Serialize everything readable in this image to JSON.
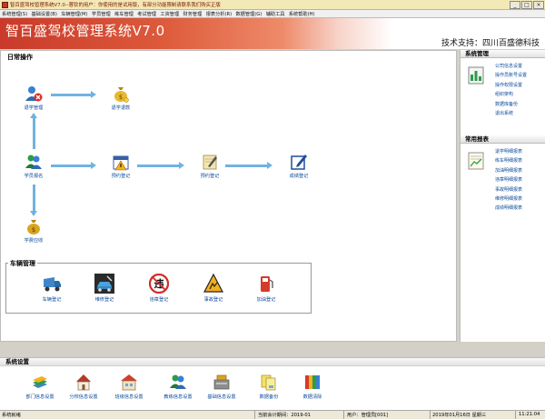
{
  "window": {
    "title": "智百盛驾校管理系统V7.0--蓉钦的用户：你使用的是试用版，有部分功能限制请联系我们购买正版",
    "minimize": "_",
    "maximize": "□",
    "close": "×"
  },
  "menu": [
    "系统管理(S)",
    "基础设置(B)",
    "车辆管理(M)",
    "学员管理",
    "练车管理",
    "考试管理",
    "工资管理",
    "财务管理",
    "报表分析(R)",
    "数据管理(G)",
    "辅助工具",
    "系统帮助(H)"
  ],
  "banner": {
    "title": "智百盛驾校管理系统V7.0",
    "support": "技术支持：四川百盛德科技"
  },
  "daily": {
    "title": "日常操作",
    "nodes": {
      "withdraw": "退学管理",
      "refund": "退学退款",
      "enroll": "学员报名",
      "schedule": "预约登记",
      "appointment": "预约登记",
      "score": "成绩登记",
      "fee": "学费应收"
    }
  },
  "vehicle": {
    "title": "车辆管理",
    "items": [
      "车辆登记",
      "维修登记",
      "违章登记",
      "事故登记",
      "加油登记"
    ]
  },
  "system_mgmt": {
    "title": "系统管理",
    "links": [
      "公司信息设置",
      "操作员账号设置",
      "操作权限设置",
      "组织架构",
      "数据库备份",
      "退出系统"
    ]
  },
  "reports": {
    "title": "常用报表",
    "links": [
      "退学明细报表",
      "练车明细报表",
      "加油明细报表",
      "违章明细报表",
      "事故明细报表",
      "维修明细报表",
      "成绩明细报表"
    ]
  },
  "settings": {
    "title": "系统设置",
    "items": [
      "部门信息设置",
      "分校信息设置",
      "班级信息设置",
      "教练信息设置",
      "基础信息设置",
      "数据备份",
      "数据清除"
    ]
  },
  "status": {
    "ready": "系统就绪",
    "period": "当前会计期间：2019-01",
    "user": "用户：管理员[001]",
    "date": "2019年01月16日 星期三",
    "time": "11:21:04"
  },
  "colors": {
    "banner_red": "#c93a2a",
    "link_blue": "#0b4a9a",
    "arrow_blue": "#6fb3e0"
  }
}
